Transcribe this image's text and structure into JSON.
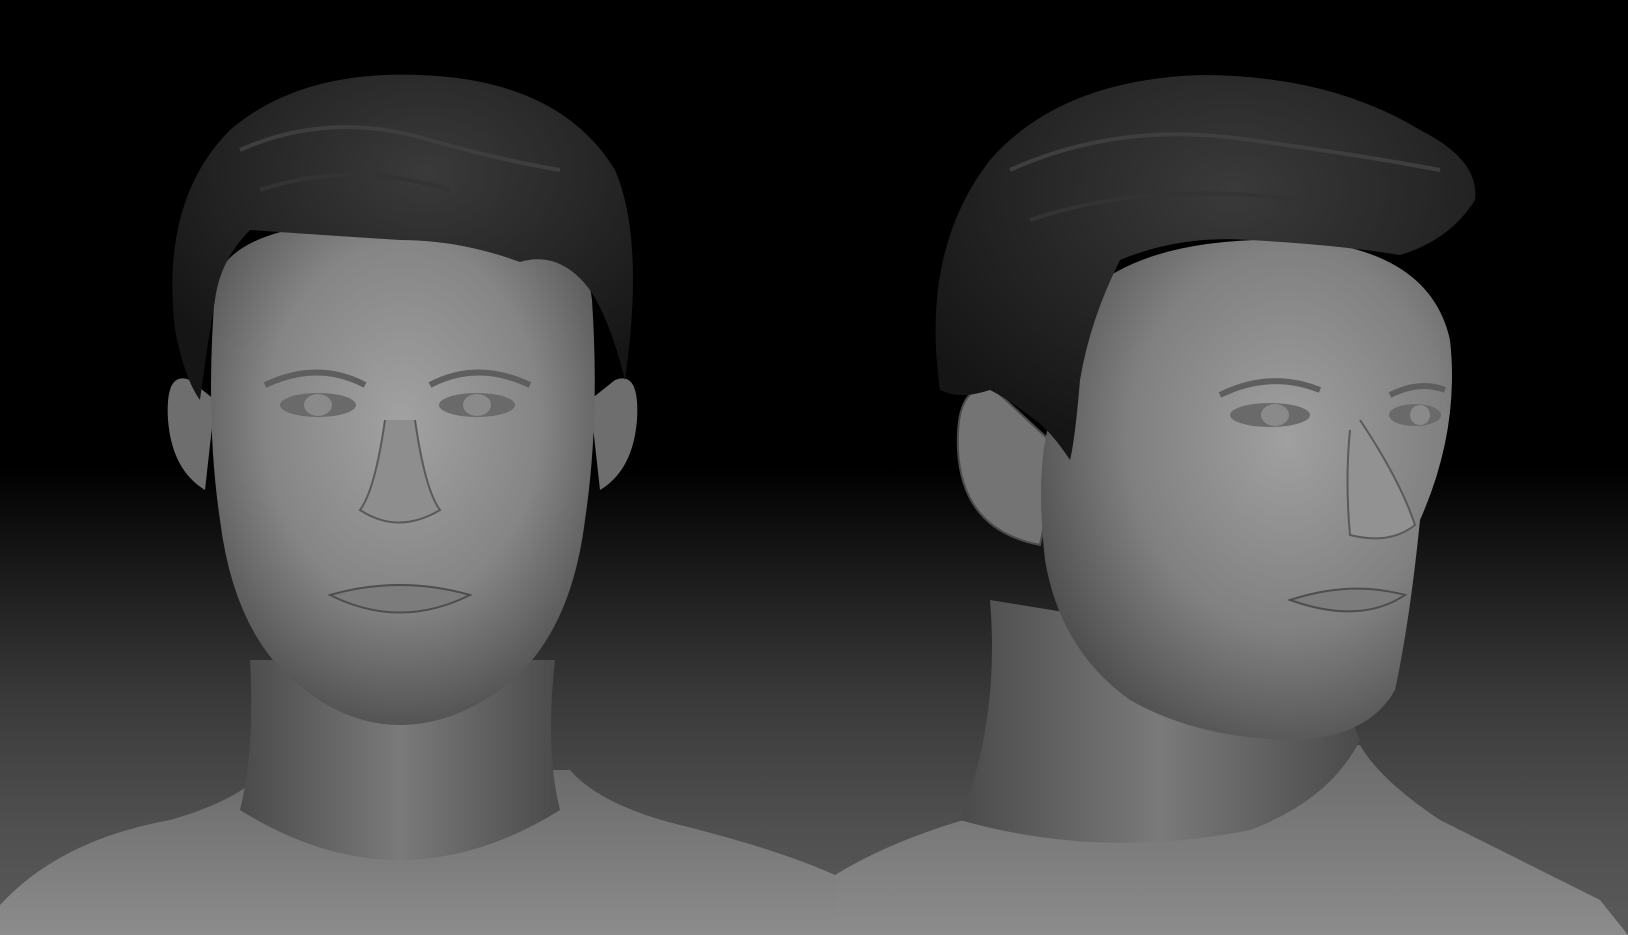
{
  "scene": {
    "description_visible_text": "",
    "models": [
      {
        "view": "front-view",
        "icon": "sculpt-head-front"
      },
      {
        "view": "three-quarter-view",
        "icon": "sculpt-head-three-quarter"
      }
    ],
    "colors": {
      "background_top": "#000000",
      "background_bottom": "#5a5a5a",
      "skin": "#8a8a8a",
      "hair": "#2a2a2a"
    }
  }
}
